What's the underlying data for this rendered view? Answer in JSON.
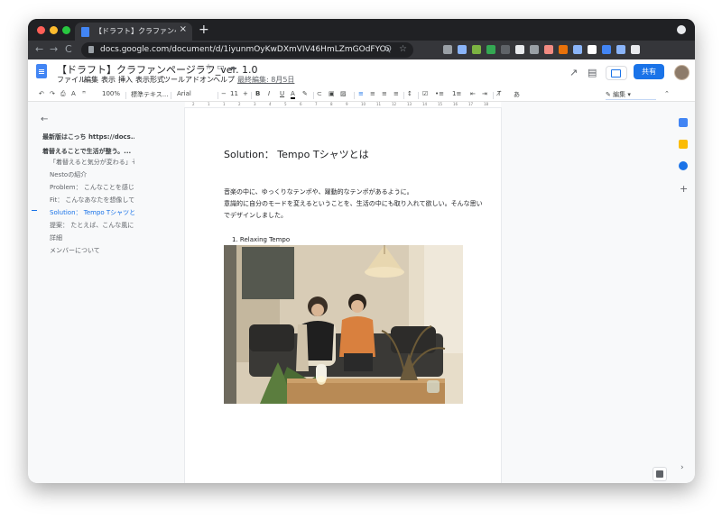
{
  "browser": {
    "tab_title": "【ドラフト】クラファンページラ",
    "tab_close": "×",
    "new_tab": "+",
    "url": "docs.google.com/document/d/1iyunmOyKwDXmVIV46HmLZmGOdFYOxPEypzioeitH5Y/e...",
    "nav": {
      "back": "←",
      "forward": "→",
      "reload": "C"
    },
    "omnibox_icons": {
      "search": "Q",
      "star": "☆"
    },
    "extension_colors": [
      "#9aa0a6",
      "#8ab4f8",
      "#7cb342",
      "#34a853",
      "#5f6368",
      "#e8eaed",
      "#9aa0a6",
      "#f28b82",
      "#e8710a",
      "#8ab4f8",
      "#ffffff",
      "#4285f4",
      "#8ab4f8",
      "#e8eaed"
    ]
  },
  "docs": {
    "title": "【ドラフト】クラファンページラフ_ver. 1.0",
    "menu": [
      "ファイル",
      "編集",
      "表示",
      "挿入",
      "表示形式",
      "ツール",
      "アドオン",
      "ヘルプ"
    ],
    "last_edit": "最終編集: 8月5日",
    "share_label": "共有",
    "toolbar": {
      "zoom": "100%",
      "style": "標準テキス...",
      "font": "Arial",
      "font_size": "11",
      "minus": "−",
      "plus": "+",
      "bold": "B",
      "italic": "I",
      "underline": "U",
      "text_color": "A",
      "input_tools": "あ",
      "edit_mode": "編集"
    },
    "ruler_ticks": [
      "2",
      "1",
      "1",
      "2",
      "3",
      "4",
      "5",
      "6",
      "7",
      "8",
      "9",
      "10",
      "11",
      "12",
      "13",
      "14",
      "15",
      "16",
      "17",
      "18"
    ]
  },
  "outline": {
    "back": "←",
    "items": [
      {
        "label": "最新版はこっち https://docs...",
        "level": 1,
        "active": false
      },
      {
        "label": "着替えることで生活が整う。...",
        "level": 1,
        "active": false
      },
      {
        "label": "「着替えると気分が変わる」そ...",
        "level": 2,
        "active": false
      },
      {
        "label": "Nestoの紹介",
        "level": 2,
        "active": false
      },
      {
        "label": "Problem： こんなことを感じた...",
        "level": 2,
        "active": false
      },
      {
        "label": "Fit： こんなあなたを想像して...",
        "level": 2,
        "active": false
      },
      {
        "label": "Solution： Tempo Tシャツとは",
        "level": 2,
        "active": true
      },
      {
        "label": "提案： たとえば、こんな風に...",
        "level": 2,
        "active": false
      },
      {
        "label": "詳細",
        "level": 2,
        "active": false
      },
      {
        "label": "メンバーについて",
        "level": 2,
        "active": false
      }
    ]
  },
  "document": {
    "heading": "Solution： Tempo Tシャツとは",
    "paragraphs": [
      "音楽の中に、ゆっくりなテンポや、躍動的なテンポがあるように。",
      "意識的に自分のモードを変えるということを、生活の中にも取り入れて欲しい。そんな思い",
      "でデザインしました。"
    ],
    "list_item": "1.   Relaxing Tempo"
  },
  "colors": {
    "accent": "#1a73e8",
    "chrome_dark": "#202124",
    "chrome_mid": "#35363a"
  }
}
